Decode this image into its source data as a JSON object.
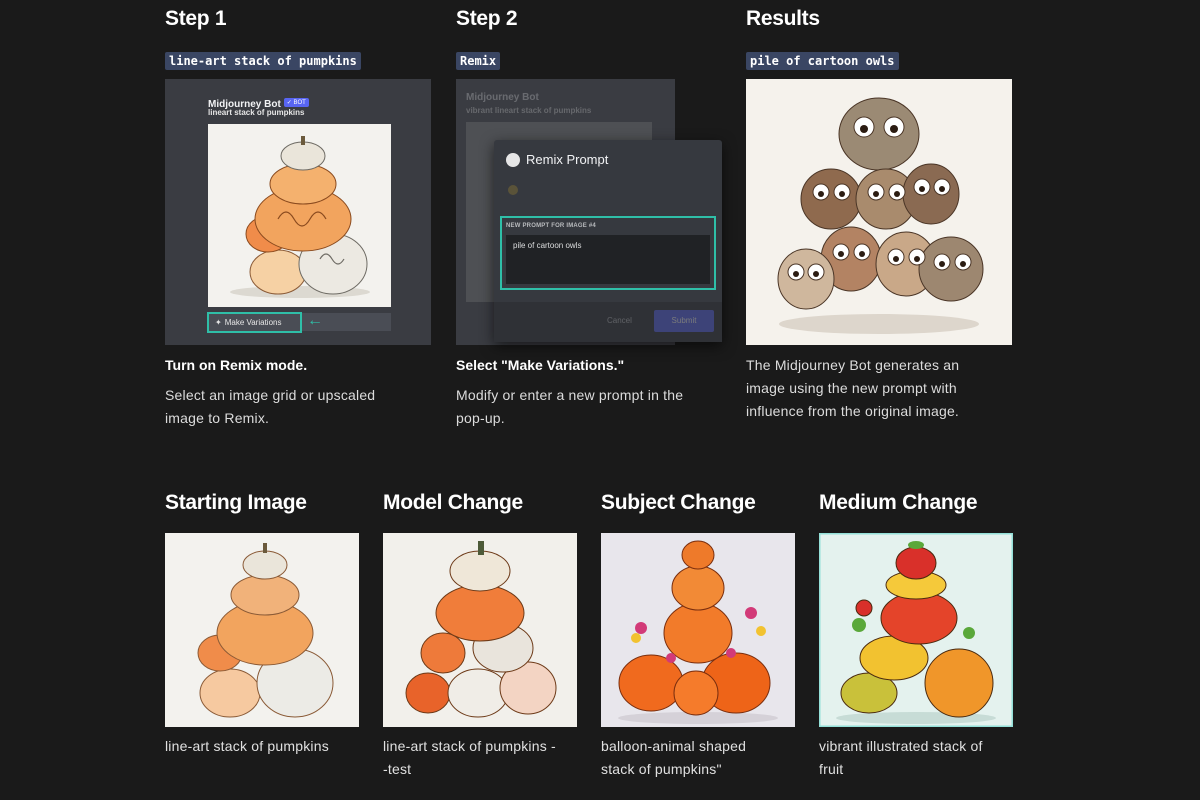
{
  "steps": [
    {
      "heading": "Step 1",
      "chip": "line-art stack of pumpkins",
      "title": "Turn on Remix mode.",
      "description_lines": [
        "Select an image grid or upscaled",
        "image to Remix."
      ]
    },
    {
      "heading": "Step 2",
      "chip": "Remix",
      "title": "Select \"Make Variations.\"",
      "description_lines": [
        "Modify or enter a new prompt in the",
        "pop-up."
      ]
    },
    {
      "heading": "Results",
      "chip": "pile of cartoon owls",
      "title": "",
      "description_lines": [
        "The Midjourney Bot generates an",
        "image using the new prompt with",
        "influence from the original image."
      ]
    }
  ],
  "discord_mock": {
    "bot_name": "Midjourney Bot",
    "bot_badge": "✓ BOT",
    "prompt": "lineart stack of pumpkins",
    "make_variations_label": "Make Variations",
    "remix_prompt_title": "Remix Prompt",
    "remix_field_label": "NEW PROMPT FOR IMAGE #4",
    "remix_field_value": "pile of cartoon owls",
    "faded_bot_name": "Midjourney Bot",
    "faded_prompt": "vibrant lineart stack of pumpkins",
    "cancel_label": "Cancel",
    "submit_label": "Submit"
  },
  "examples": [
    {
      "heading": "Starting Image",
      "caption_lines": [
        "line-art stack of pumpkins"
      ],
      "kind": "pumpkin-lineart"
    },
    {
      "heading": "Model Change",
      "caption_lines": [
        "line-art stack of pumpkins -",
        "-test"
      ],
      "kind": "pumpkin-test"
    },
    {
      "heading": "Subject Change",
      "caption_lines": [
        "balloon-animal shaped",
        "stack of pumpkins\""
      ],
      "kind": "pumpkin-balloon"
    },
    {
      "heading": "Medium Change",
      "caption_lines": [
        "vibrant illustrated stack of",
        "fruit"
      ],
      "kind": "fruit"
    }
  ],
  "colors": {
    "background": "#1a1a1a",
    "chip_bg": "#3a4663",
    "accent_teal": "#2fbfa8",
    "discord_panel": "#3a3c42"
  }
}
